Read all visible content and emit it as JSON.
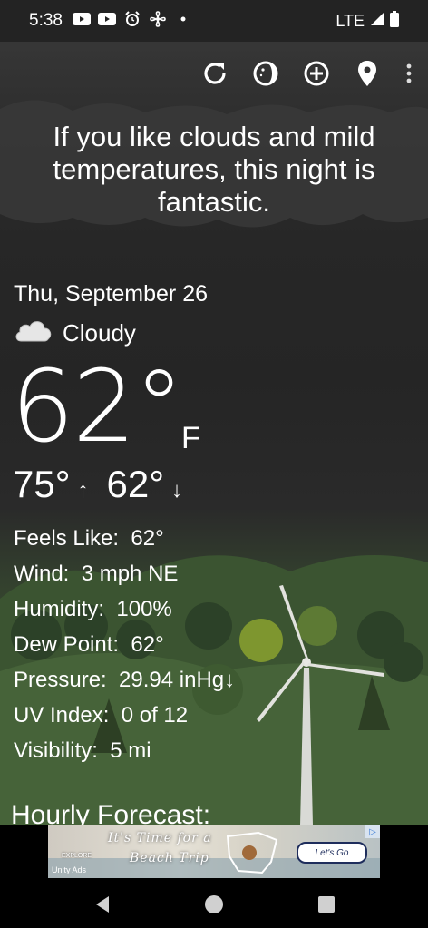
{
  "status_bar": {
    "time": "5:38",
    "icons_left": [
      "youtube-icon",
      "youtube-icon",
      "alarm-icon",
      "fan-icon",
      "dot-icon"
    ],
    "network": "LTE",
    "icons_right": [
      "signal-icon",
      "battery-icon"
    ]
  },
  "toolbar": {
    "buttons": [
      "refresh-icon",
      "moon-phase-icon",
      "add-location-icon",
      "location-pin-icon",
      "more-vert-icon"
    ]
  },
  "headline": "If you like clouds and mild temperatures, this night is fantastic.",
  "current": {
    "date": "Thu, September 26",
    "condition": "Cloudy",
    "condition_icon": "cloud-icon",
    "temperature": "62°",
    "unit": "F",
    "high": "75°",
    "low": "62°"
  },
  "details": [
    {
      "label": "Feels Like:",
      "value": "62°"
    },
    {
      "label": "Wind:",
      "value": "3 mph NE"
    },
    {
      "label": "Humidity:",
      "value": "100%"
    },
    {
      "label": "Dew Point:",
      "value": "62°"
    },
    {
      "label": "Pressure:",
      "value": "29.94 inHg↓"
    },
    {
      "label": "UV Index:",
      "value": "0 of 12"
    },
    {
      "label": "Visibility:",
      "value": "5 mi"
    }
  ],
  "section": {
    "hourly_title": "Hourly Forecast:"
  },
  "ad": {
    "line1": "It's Time for a",
    "line2": "Beach Trip",
    "explore": "EXPLORE",
    "brand": "Unity Ads",
    "cta": "Let's Go"
  },
  "colors": {
    "background_top": "#2f2f2f",
    "background_bottom": "#3c5432",
    "text": "#ffffff"
  }
}
